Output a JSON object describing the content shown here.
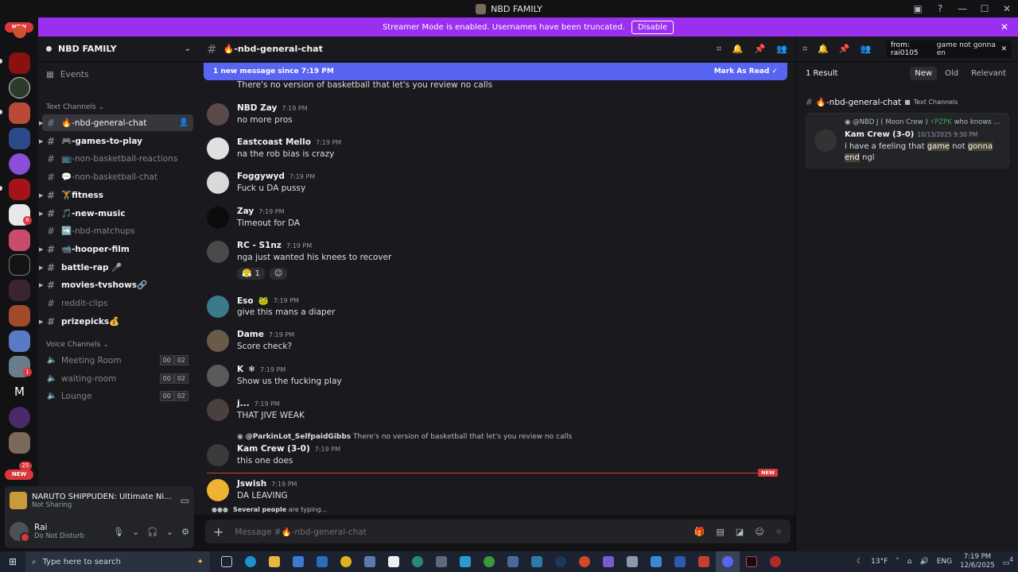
{
  "window": {
    "title": "NBD FAMILY"
  },
  "banner": {
    "text": "Streamer Mode is enabled. Usernames have been truncated.",
    "disable_label": "Disable"
  },
  "rail": {
    "new_top": "NEW",
    "new_bottom": "NEW",
    "badge_1": "6",
    "badge_2": "1",
    "badge_3": "25"
  },
  "server": {
    "name": "NBD FAMILY",
    "events_label": "Events",
    "text_category": "Text Channels",
    "voice_category": "Voice Channels",
    "text_channels": [
      {
        "name": "🔥-nbd-general-chat",
        "state": "active"
      },
      {
        "name": "🎮-games-to-play",
        "state": "unread"
      },
      {
        "name": "📺-non-basketball-reactions",
        "state": "read"
      },
      {
        "name": "💬-non-basketball-chat",
        "state": "read"
      },
      {
        "name": "🏋️fitness",
        "state": "unread"
      },
      {
        "name": "🎵-new-music",
        "state": "unread"
      },
      {
        "name": "➡️-nbd-matchups",
        "state": "read"
      },
      {
        "name": "📹-hooper-film",
        "state": "unread"
      },
      {
        "name": "battle-rap 🎤",
        "state": "unread"
      },
      {
        "name": "movies-tvshows🔗",
        "state": "unread"
      },
      {
        "name": "reddit-clips",
        "state": "read"
      },
      {
        "name": "prizepicks💰",
        "state": "unread"
      }
    ],
    "voice_channels": [
      {
        "name": "Meeting Room",
        "count_a": "00",
        "count_b": "02"
      },
      {
        "name": "waiting-room",
        "count_a": "00",
        "count_b": "02"
      },
      {
        "name": "Lounge",
        "count_a": "00",
        "count_b": "02"
      }
    ]
  },
  "activity": {
    "title": "NARUTO SHIPPUDEN: Ultimate Ni...",
    "status": "Not Sharing"
  },
  "user": {
    "name": "Rai",
    "status": "Do Not Disturb"
  },
  "channel": {
    "name": "🔥-nbd-general-chat"
  },
  "new_bar": {
    "text": "1 new message since 7:19 PM",
    "mark_label": "Mark As Read"
  },
  "messages": {
    "first_line": "There's no version of basketball that let's you review no calls",
    "m1": {
      "author": "NBD Zay",
      "time": "7:19 PM",
      "text": "no more pros"
    },
    "m2": {
      "author": "Eastcoast Mello",
      "time": "7:19 PM",
      "text": "na the rob bias is crazy"
    },
    "m3": {
      "author": "Foggywyd",
      "time": "7:19 PM",
      "text": "Fuck u DA pussy"
    },
    "m4": {
      "author": "Zay",
      "time": "7:19 PM",
      "text": "Timeout for DA"
    },
    "m5": {
      "author": "RC - S1nz",
      "time": "7:19 PM",
      "text": "nga just wanted his knees to recover",
      "reaction_emoji": "😤",
      "reaction_count": "1",
      "add_reaction": "☺"
    },
    "m6": {
      "author": "Eso",
      "time": "7:19 PM",
      "text": "give this mans a diaper",
      "badge": "🐸"
    },
    "m7": {
      "author": "Dame",
      "time": "7:19 PM",
      "text": "Score check?"
    },
    "m8": {
      "author": "K",
      "time": "7:19 PM",
      "text": "Show us the fucking play",
      "badge": "❄"
    },
    "m9": {
      "author": "j...",
      "time": "7:19 PM",
      "text": "THAT JIVE WEAK"
    },
    "m10": {
      "reply_user": "@ParkinLot_SelfpaidGibbs",
      "reply_text": "There's no version of basketball that let's you review no calls",
      "author": "Kam Crew (3-0)",
      "time": "7:19 PM",
      "text": "this one does"
    },
    "new_label": "NEW",
    "m11": {
      "author": "Jswish",
      "time": "7:19 PM",
      "text": "DA LEAVING"
    }
  },
  "typing": {
    "who": "Several people",
    "rest": "are typing..."
  },
  "composer": {
    "placeholder": "Message #🔥-nbd-general-chat"
  },
  "search": {
    "query_from": "from: rai0105",
    "query_text": "game not gonna en",
    "results_count": "1 Result",
    "sort_new": "New",
    "sort_old": "Old",
    "sort_relevant": "Relevant",
    "result_channel": "🔥-nbd-general-chat",
    "result_category": "Text Channels",
    "reply_user": "@NBD J ( Moon Crew )",
    "reply_tag": "⚡PZPK",
    "reply_text": "who knows ...",
    "author": "Kam Crew (3-0)",
    "time": "10/13/2025 9:30 PM",
    "text_1": "i have a feeling that ",
    "hl_1": "game",
    "text_2": " not ",
    "hl_2": "gonna",
    "text_3": " ",
    "hl_3": "end",
    "text_4": " ngl"
  },
  "taskbar": {
    "search_placeholder": "Type here to search",
    "weather": "13°F",
    "lang": "ENG",
    "time": "7:19 PM",
    "date": "12/6/2025",
    "notif_count": "4"
  },
  "colors": {
    "accent": "#5865f2",
    "banner": "#9b2ff0",
    "danger": "#da373c"
  }
}
